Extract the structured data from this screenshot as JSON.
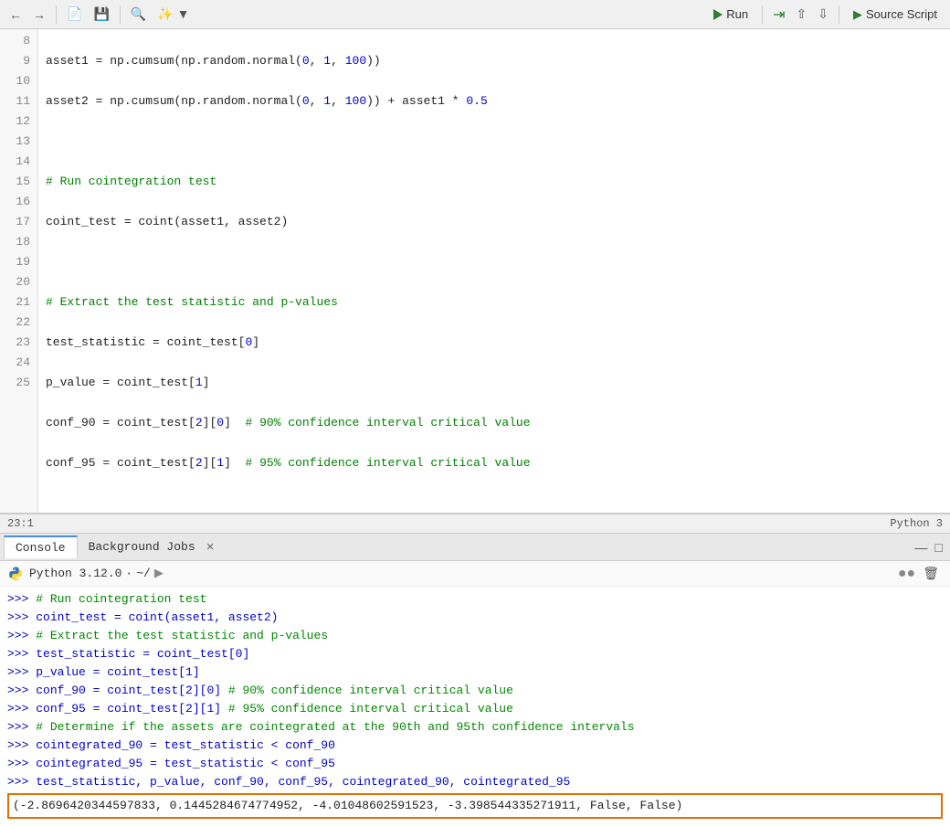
{
  "toolbar": {
    "run_label": "Run",
    "source_script_label": "Source Script"
  },
  "editor": {
    "lines": [
      {
        "num": "8",
        "content": "asset1 = np.cumsum(np.random.normal(0, 1, 100))",
        "type": "code"
      },
      {
        "num": "9",
        "content": "asset2 = np.cumsum(np.random.normal(0, 1, 100)) + asset1 * 0.5",
        "type": "code"
      },
      {
        "num": "10",
        "content": "",
        "type": "empty"
      },
      {
        "num": "11",
        "content": "# Run cointegration test",
        "type": "comment"
      },
      {
        "num": "12",
        "content": "coint_test = coint(asset1, asset2)",
        "type": "code"
      },
      {
        "num": "13",
        "content": "",
        "type": "empty"
      },
      {
        "num": "14",
        "content": "# Extract the test statistic and p-values",
        "type": "comment"
      },
      {
        "num": "15",
        "content": "test_statistic = coint_test[0]",
        "type": "code"
      },
      {
        "num": "16",
        "content": "p_value = coint_test[1]",
        "type": "code"
      },
      {
        "num": "17",
        "content": "conf_90 = coint_test[2][0]  # 90% confidence interval critical value",
        "type": "code_comment"
      },
      {
        "num": "18",
        "content": "conf_95 = coint_test[2][1]  # 95% confidence interval critical value",
        "type": "code_comment"
      },
      {
        "num": "19",
        "content": "",
        "type": "empty"
      },
      {
        "num": "20",
        "content": "# Determine if the assets are cointegrated at the 90th and 95th confidence intervals",
        "type": "comment"
      },
      {
        "num": "21",
        "content": "cointegrated_90 = test_statistic < conf_90",
        "type": "code"
      },
      {
        "num": "22",
        "content": "cointegrated_95 = test_statistic < conf_95",
        "type": "code"
      },
      {
        "num": "23",
        "content": "",
        "type": "cursor"
      },
      {
        "num": "24",
        "content": "test_statistic, p_value, conf_90, conf_95, cointegrated_90, cointegrated_95",
        "type": "code"
      },
      {
        "num": "25",
        "content": "",
        "type": "empty"
      }
    ]
  },
  "status_bar": {
    "position": "23:1",
    "language": "Python 3"
  },
  "console": {
    "tabs": [
      "Console",
      "Background Jobs"
    ],
    "python_version": "Python 3.12.0",
    "working_dir": "~/",
    "output_lines": [
      ">>> # Run cointegration test",
      ">>> coint_test = coint(asset1, asset2)",
      ">>> # Extract the test statistic and p-values",
      ">>> test_statistic = coint_test[0]",
      ">>> p_value = coint_test[1]",
      ">>> conf_90 = coint_test[2][0]  # 90% confidence interval critical value",
      ">>> conf_95 = coint_test[2][1]  # 95% confidence interval critical value",
      ">>> # Determine if the assets are cointegrated at the 90th and 95th confidence intervals",
      ">>> cointegrated_90 = test_statistic < conf_90",
      ">>> cointegrated_95 = test_statistic < conf_95",
      ">>> test_statistic, p_value, conf_90, conf_95, cointegrated_90, cointegrated_95"
    ],
    "result": "(-2.8696420344597833, 0.1445284674774952, -4.01048602591523, -3.398544335271911, False, False)"
  }
}
